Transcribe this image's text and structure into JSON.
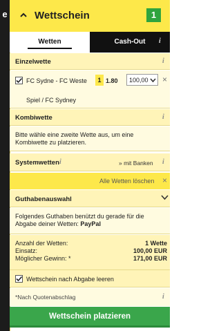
{
  "left_edge_label": "e",
  "header": {
    "title": "Wettschein",
    "count": "1"
  },
  "tabs": [
    {
      "label": "Wetten",
      "active": true
    },
    {
      "label": "Cash-Out",
      "active": false
    }
  ],
  "einzelwette": {
    "title": "Einzelwette",
    "bet": {
      "checked": true,
      "match": "FC Sydne - FC Weste",
      "selection": "1",
      "odds": "1.80",
      "stake": "100,00",
      "market": "Spiel / FC Sydney"
    }
  },
  "kombiwette": {
    "title": "Kombiwette",
    "message": "Bitte wähle eine zweite Wette aus, um eine Kombiwette zu platzieren."
  },
  "systemwetten": {
    "title": "Systemwetten",
    "banker_label": "» mit Banken"
  },
  "clear_all": "Alle Wetten löschen",
  "guthaben": {
    "title": "Guthabenauswahl",
    "message": "Folgendes Guthaben benützt du gerade für die Abgabe deiner Wetten:",
    "method": "PayPal"
  },
  "summary": {
    "anzahl_label": "Anzahl der Wetten:",
    "anzahl_value": "1 Wette",
    "einsatz_label": "Einsatz:",
    "einsatz_value": "100,00 EUR",
    "gewinn_label": "Möglicher Gewinn: *",
    "gewinn_value": "171,00 EUR"
  },
  "clear_after": {
    "checked": true,
    "label": "Wettschein nach Abgabe leeren"
  },
  "footnote": "*Nach Quotenabschlag",
  "submit_label": "Wettschein platzieren",
  "colors": {
    "accent_yellow": "#fde84a",
    "header_green_badge": "#2fa43e",
    "submit_green": "#3aa64b"
  }
}
